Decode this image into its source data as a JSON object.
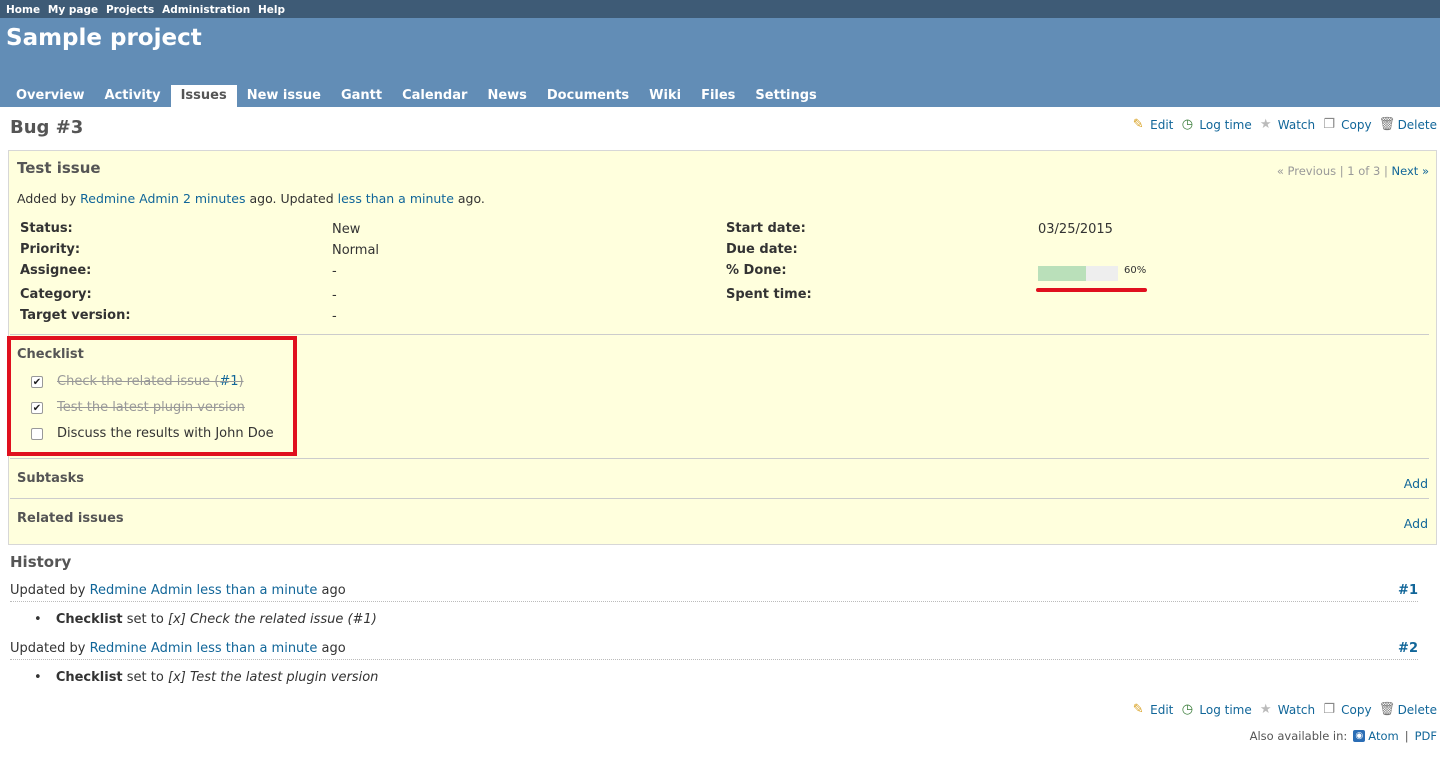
{
  "top_menu": [
    "Home",
    "My page",
    "Projects",
    "Administration",
    "Help"
  ],
  "project_title": "Sample project",
  "main_menu": [
    "Overview",
    "Activity",
    "Issues",
    "New issue",
    "Gantt",
    "Calendar",
    "News",
    "Documents",
    "Wiki",
    "Files",
    "Settings"
  ],
  "active_tab": "Issues",
  "page_title": "Bug #3",
  "actions": {
    "edit": "Edit",
    "log_time": "Log time",
    "watch": "Watch",
    "copy": "Copy",
    "delete": "Delete"
  },
  "issue": {
    "subject": "Test issue",
    "nav": {
      "previous": "« Previous",
      "position": "1 of 3",
      "next": "Next »"
    },
    "author_line": {
      "prefix": "Added by",
      "author": "Redmine Admin",
      "added_ago": "2 minutes",
      "mid": "ago. Updated",
      "updated_ago": "less than a minute",
      "suffix": "ago."
    },
    "attributes": {
      "status_label": "Status:",
      "status": "New",
      "priority_label": "Priority:",
      "priority": "Normal",
      "assignee_label": "Assignee:",
      "assignee": "-",
      "category_label": "Category:",
      "category": "-",
      "target_version_label": "Target version:",
      "target_version": "-",
      "start_date_label": "Start date:",
      "start_date": "03/25/2015",
      "due_date_label": "Due date:",
      "due_date": "",
      "done_label": "% Done:",
      "done_percent": 60,
      "done_text": "60%",
      "spent_time_label": "Spent time:",
      "spent_time": "-"
    },
    "checklist": {
      "title": "Checklist",
      "items": [
        {
          "text": "Check the related issue (",
          "link": "#1",
          "text_after": ")",
          "checked": true
        },
        {
          "text": "Test the latest plugin version",
          "checked": true
        },
        {
          "text": "Discuss the results with John Doe",
          "checked": false
        }
      ]
    },
    "subtasks": {
      "title": "Subtasks",
      "add": "Add"
    },
    "related": {
      "title": "Related issues",
      "add": "Add"
    }
  },
  "history": {
    "title": "History",
    "journals": [
      {
        "prefix": "Updated by",
        "author": "Redmine Admin",
        "ago": "less than a minute",
        "suffix": "ago",
        "num": "#1",
        "detail": {
          "field": "Checklist",
          "set_to": "set to",
          "value": "[x] Check the related issue (#1)"
        }
      },
      {
        "prefix": "Updated by",
        "author": "Redmine Admin",
        "ago": "less than a minute",
        "suffix": "ago",
        "num": "#2",
        "detail": {
          "field": "Checklist",
          "set_to": "set to",
          "value": "[x] Test the latest plugin version"
        }
      }
    ]
  },
  "footer": {
    "also_available": "Also available in:",
    "atom": "Atom",
    "sep": "|",
    "pdf": "PDF"
  },
  "colors": {
    "header": "#628db6",
    "top_menu": "#3e5b76",
    "issue_bg": "#ffffdd",
    "highlight": "#e0101e",
    "progress_done": "#bae0ba",
    "link": "#169"
  }
}
